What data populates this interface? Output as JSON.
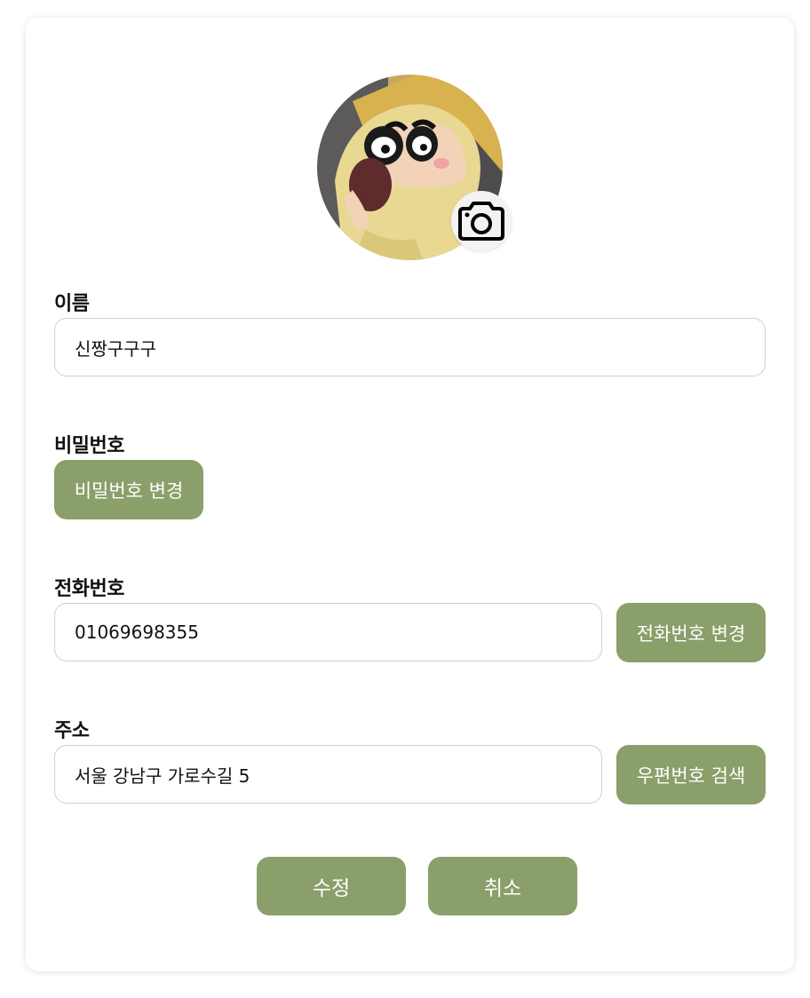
{
  "colors": {
    "accent": "#8a9f6a",
    "card_bg": "#ffffff",
    "input_border": "#cfcfcf"
  },
  "profile": {
    "avatar_icon": "cartoon-avatar",
    "camera_icon": "camera-icon"
  },
  "name": {
    "label": "이름",
    "value": "신짱구구구"
  },
  "password": {
    "label": "비밀번호",
    "change_button": "비밀번호 변경"
  },
  "phone": {
    "label": "전화번호",
    "value": "01069698355",
    "change_button": "전화번호 변경"
  },
  "address": {
    "label": "주소",
    "value": "서울 강남구 가로수길 5",
    "search_button": "우편번호 검색"
  },
  "actions": {
    "submit": "수정",
    "cancel": "취소"
  }
}
